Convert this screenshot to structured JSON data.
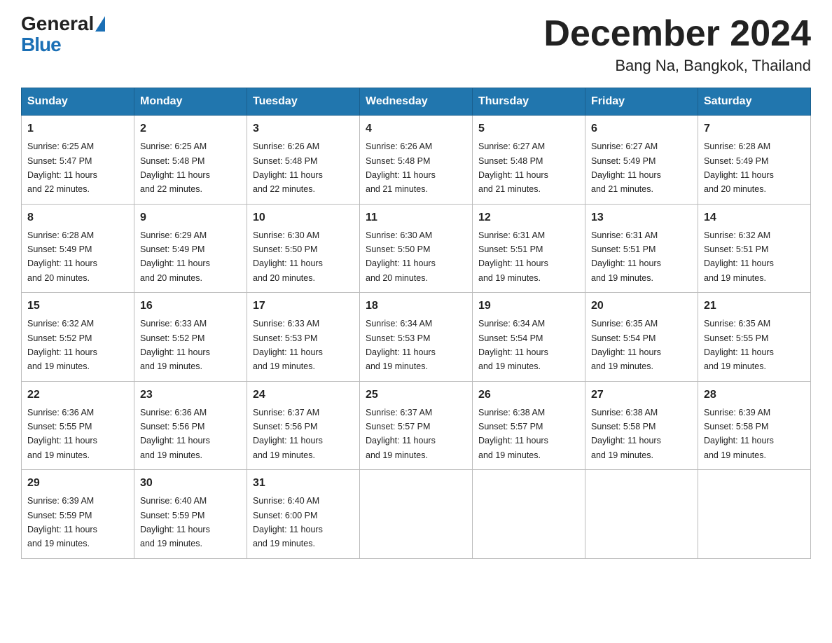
{
  "header": {
    "logo_general": "General",
    "logo_blue": "Blue",
    "title": "December 2024",
    "subtitle": "Bang Na, Bangkok, Thailand"
  },
  "days_of_week": [
    "Sunday",
    "Monday",
    "Tuesday",
    "Wednesday",
    "Thursday",
    "Friday",
    "Saturday"
  ],
  "weeks": [
    [
      {
        "day": "1",
        "sunrise": "6:25 AM",
        "sunset": "5:47 PM",
        "daylight": "11 hours and 22 minutes."
      },
      {
        "day": "2",
        "sunrise": "6:25 AM",
        "sunset": "5:48 PM",
        "daylight": "11 hours and 22 minutes."
      },
      {
        "day": "3",
        "sunrise": "6:26 AM",
        "sunset": "5:48 PM",
        "daylight": "11 hours and 22 minutes."
      },
      {
        "day": "4",
        "sunrise": "6:26 AM",
        "sunset": "5:48 PM",
        "daylight": "11 hours and 21 minutes."
      },
      {
        "day": "5",
        "sunrise": "6:27 AM",
        "sunset": "5:48 PM",
        "daylight": "11 hours and 21 minutes."
      },
      {
        "day": "6",
        "sunrise": "6:27 AM",
        "sunset": "5:49 PM",
        "daylight": "11 hours and 21 minutes."
      },
      {
        "day": "7",
        "sunrise": "6:28 AM",
        "sunset": "5:49 PM",
        "daylight": "11 hours and 20 minutes."
      }
    ],
    [
      {
        "day": "8",
        "sunrise": "6:28 AM",
        "sunset": "5:49 PM",
        "daylight": "11 hours and 20 minutes."
      },
      {
        "day": "9",
        "sunrise": "6:29 AM",
        "sunset": "5:49 PM",
        "daylight": "11 hours and 20 minutes."
      },
      {
        "day": "10",
        "sunrise": "6:30 AM",
        "sunset": "5:50 PM",
        "daylight": "11 hours and 20 minutes."
      },
      {
        "day": "11",
        "sunrise": "6:30 AM",
        "sunset": "5:50 PM",
        "daylight": "11 hours and 20 minutes."
      },
      {
        "day": "12",
        "sunrise": "6:31 AM",
        "sunset": "5:51 PM",
        "daylight": "11 hours and 19 minutes."
      },
      {
        "day": "13",
        "sunrise": "6:31 AM",
        "sunset": "5:51 PM",
        "daylight": "11 hours and 19 minutes."
      },
      {
        "day": "14",
        "sunrise": "6:32 AM",
        "sunset": "5:51 PM",
        "daylight": "11 hours and 19 minutes."
      }
    ],
    [
      {
        "day": "15",
        "sunrise": "6:32 AM",
        "sunset": "5:52 PM",
        "daylight": "11 hours and 19 minutes."
      },
      {
        "day": "16",
        "sunrise": "6:33 AM",
        "sunset": "5:52 PM",
        "daylight": "11 hours and 19 minutes."
      },
      {
        "day": "17",
        "sunrise": "6:33 AM",
        "sunset": "5:53 PM",
        "daylight": "11 hours and 19 minutes."
      },
      {
        "day": "18",
        "sunrise": "6:34 AM",
        "sunset": "5:53 PM",
        "daylight": "11 hours and 19 minutes."
      },
      {
        "day": "19",
        "sunrise": "6:34 AM",
        "sunset": "5:54 PM",
        "daylight": "11 hours and 19 minutes."
      },
      {
        "day": "20",
        "sunrise": "6:35 AM",
        "sunset": "5:54 PM",
        "daylight": "11 hours and 19 minutes."
      },
      {
        "day": "21",
        "sunrise": "6:35 AM",
        "sunset": "5:55 PM",
        "daylight": "11 hours and 19 minutes."
      }
    ],
    [
      {
        "day": "22",
        "sunrise": "6:36 AM",
        "sunset": "5:55 PM",
        "daylight": "11 hours and 19 minutes."
      },
      {
        "day": "23",
        "sunrise": "6:36 AM",
        "sunset": "5:56 PM",
        "daylight": "11 hours and 19 minutes."
      },
      {
        "day": "24",
        "sunrise": "6:37 AM",
        "sunset": "5:56 PM",
        "daylight": "11 hours and 19 minutes."
      },
      {
        "day": "25",
        "sunrise": "6:37 AM",
        "sunset": "5:57 PM",
        "daylight": "11 hours and 19 minutes."
      },
      {
        "day": "26",
        "sunrise": "6:38 AM",
        "sunset": "5:57 PM",
        "daylight": "11 hours and 19 minutes."
      },
      {
        "day": "27",
        "sunrise": "6:38 AM",
        "sunset": "5:58 PM",
        "daylight": "11 hours and 19 minutes."
      },
      {
        "day": "28",
        "sunrise": "6:39 AM",
        "sunset": "5:58 PM",
        "daylight": "11 hours and 19 minutes."
      }
    ],
    [
      {
        "day": "29",
        "sunrise": "6:39 AM",
        "sunset": "5:59 PM",
        "daylight": "11 hours and 19 minutes."
      },
      {
        "day": "30",
        "sunrise": "6:40 AM",
        "sunset": "5:59 PM",
        "daylight": "11 hours and 19 minutes."
      },
      {
        "day": "31",
        "sunrise": "6:40 AM",
        "sunset": "6:00 PM",
        "daylight": "11 hours and 19 minutes."
      },
      null,
      null,
      null,
      null
    ]
  ],
  "labels": {
    "sunrise": "Sunrise:",
    "sunset": "Sunset:",
    "daylight": "Daylight:"
  }
}
